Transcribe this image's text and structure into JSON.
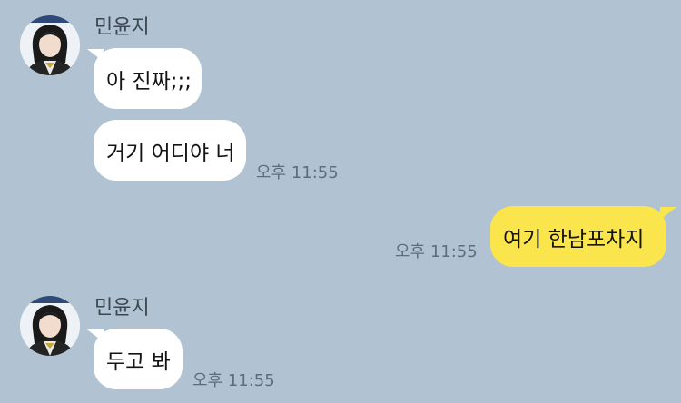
{
  "chat": {
    "background_color": "#b1c3d3",
    "incoming_bubble_color": "#ffffff",
    "outgoing_bubble_color": "#fbe54d",
    "groups": [
      {
        "sender": "민윤지",
        "avatar_icon": "profile-photo-icon",
        "messages": [
          "아 진짜;;;",
          "거기 어디야 너"
        ],
        "time": "오후 11:55"
      },
      {
        "outgoing": true,
        "messages": [
          "여기 한남포차지"
        ],
        "time": "오후 11:55"
      },
      {
        "sender": "민윤지",
        "avatar_icon": "profile-photo-icon",
        "messages": [
          "두고 봐"
        ],
        "time": "오후 11:55"
      }
    ]
  }
}
